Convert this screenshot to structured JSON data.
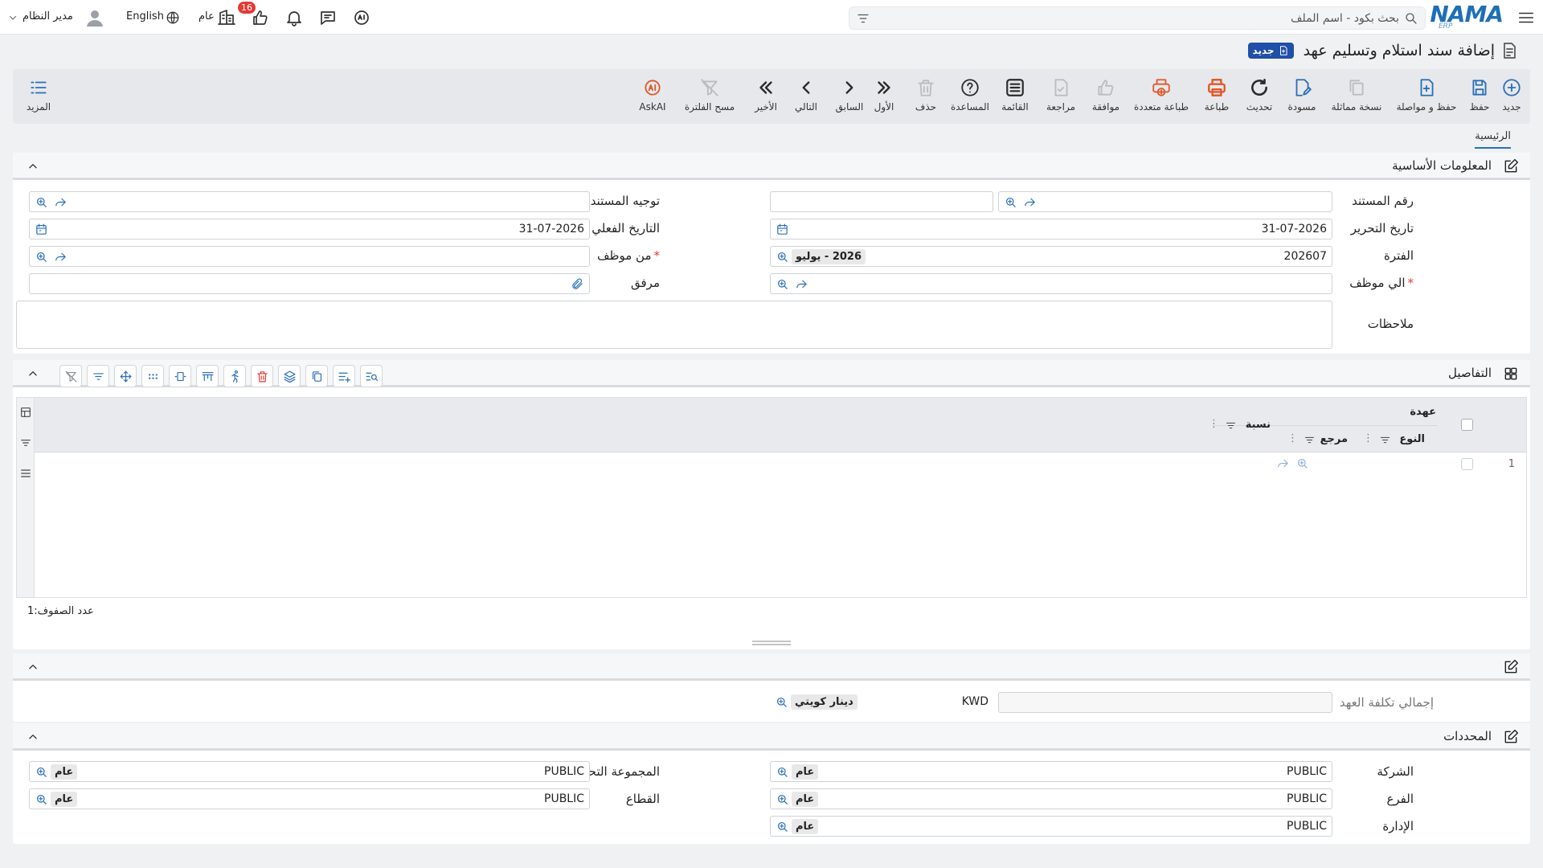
{
  "app": {
    "brand": "NAMA",
    "brand_sub": "ERP"
  },
  "topbar": {
    "search_placeholder": "بحث بكود - اسم الملف",
    "user_name": "مدير النظام",
    "language": "English",
    "scope": "عام",
    "notification_count": "16"
  },
  "page": {
    "title": "إضافة سند استلام وتسليم عهد",
    "badge": "جديد"
  },
  "toolbar": {
    "new": "جديد",
    "save": "حفظ",
    "save_continue": "حفظ و مواصلة",
    "duplicate": "نسخة مماثلة",
    "draft": "مسودة",
    "refresh": "تحديث",
    "print": "طباعة",
    "multi_print": "طباعة متعددة",
    "approve": "موافقة",
    "review": "مراجعة",
    "list": "القائمة",
    "help": "المساعدة",
    "delete": "حذف",
    "first": "الأول",
    "prev": "السابق",
    "next": "التالي",
    "last": "الأخير",
    "clear_filter": "مسح الفلترة",
    "askai": "AskAI",
    "more": "المزيد"
  },
  "tabs": {
    "main": "الرئيسية"
  },
  "basic": {
    "title": "المعلومات الأساسية",
    "doc_number_label": "رقم المستند",
    "doc_direction_label": "توجيه المستند",
    "edit_date_label": "تاريخ التحرير",
    "edit_date": "31-07-2026",
    "actual_date_label": "التاريخ الفعلي",
    "actual_date": "31-07-2026",
    "period_label": "الفترة",
    "period_code": "202607",
    "period_name": "2026 - يوليو",
    "from_employee_label": "من موظف",
    "to_employee_label": "الي موظف",
    "attachment_label": "مرفق",
    "notes_label": "ملاحظات"
  },
  "details": {
    "title": "التفاصيل",
    "group_header": "عهدة",
    "col_type": "النوع",
    "col_ref": "مرجع",
    "col_ratio": "نسبة",
    "row_number": "1",
    "rows_count_label": "عدد الصفوف:",
    "rows_count": "1"
  },
  "totals": {
    "total_cost_label": "إجمالي تكلفة العهد",
    "currency_code": "KWD",
    "currency_name": "دينار كويتي"
  },
  "dimensions": {
    "title": "المحددات",
    "company_label": "الشركة",
    "company_code": "PUBLIC",
    "company_name": "عام",
    "analytic_label": "المجموعة التحليلية",
    "analytic_code": "PUBLIC",
    "analytic_name": "عام",
    "branch_label": "الفرع",
    "branch_code": "PUBLIC",
    "branch_name": "عام",
    "sector_label": "القطاع",
    "sector_code": "PUBLIC",
    "sector_name": "عام",
    "department_label": "الإدارة",
    "department_code": "PUBLIC",
    "department_name": "عام"
  }
}
